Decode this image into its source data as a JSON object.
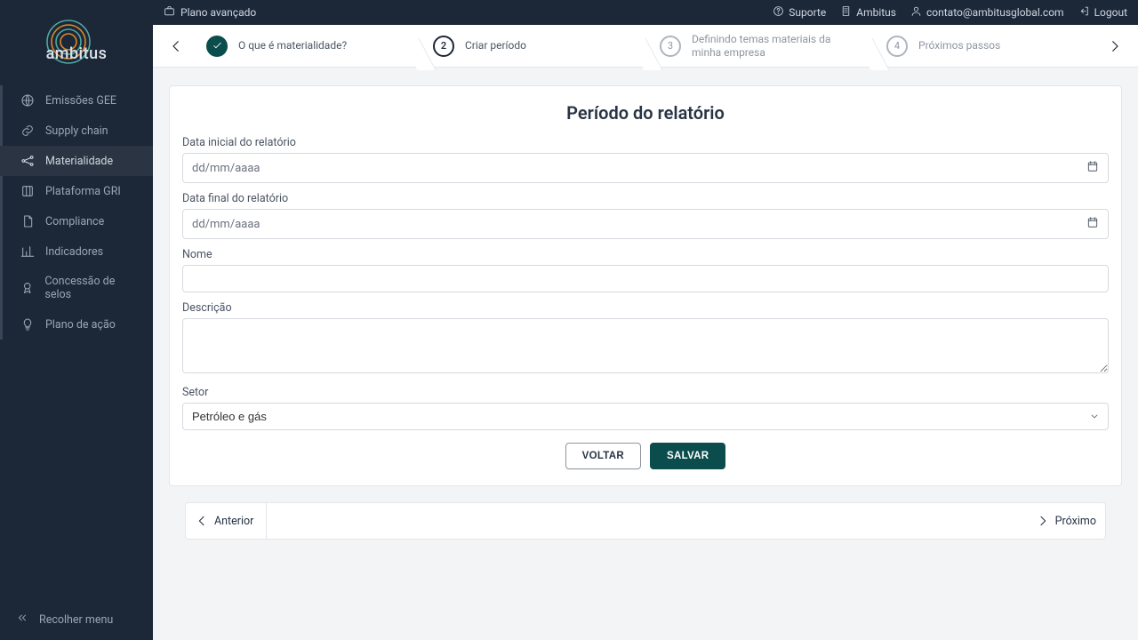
{
  "brand_name": "ambitus",
  "topbar": {
    "plan_label": "Plano avançado",
    "links": {
      "support": "Suporte",
      "brand": "Ambitus",
      "contact": "contato@ambitusglobal.com",
      "logout": "Logout"
    }
  },
  "sidebar": {
    "items": [
      {
        "label": "Emissões GEE",
        "icon": "globe-icon"
      },
      {
        "label": "Supply chain",
        "icon": "link-icon"
      },
      {
        "label": "Materialidade",
        "icon": "nodes-icon",
        "active": true
      },
      {
        "label": "Plataforma GRI",
        "icon": "columns-icon"
      },
      {
        "label": "Compliance",
        "icon": "doc-icon"
      },
      {
        "label": "Indicadores",
        "icon": "chart-icon"
      },
      {
        "label": "Concessão de selos",
        "icon": "badge-icon"
      },
      {
        "label": "Plano de ação",
        "icon": "bulb-icon"
      }
    ],
    "collapse_label": "Recolher menu"
  },
  "stepper": {
    "steps": [
      {
        "label": "O que é materialidade?",
        "state": "done"
      },
      {
        "label": "Criar período",
        "state": "current",
        "num": "2"
      },
      {
        "label": "Definindo temas materiais da minha empresa",
        "state": "upcoming",
        "num": "3"
      },
      {
        "label": "Próximos passos",
        "state": "upcoming",
        "num": "4"
      }
    ]
  },
  "form": {
    "title": "Período do relatório",
    "start_label": "Data inicial do relatório",
    "end_label": "Data final do relatório",
    "date_placeholder": "dd/mm/aaaa",
    "name_label": "Nome",
    "desc_label": "Descrição",
    "sector_label": "Setor",
    "sector_value": "Petróleo e gás",
    "back_btn": "VOLTAR",
    "save_btn": "SALVAR"
  },
  "pager": {
    "prev": "Anterior",
    "next": "Próximo"
  },
  "colors": {
    "sidebar_bg": "#1c2738",
    "accent": "#0b4d4d",
    "logo_orange": "#d98a2b",
    "logo_teal": "#4fa8a0"
  }
}
